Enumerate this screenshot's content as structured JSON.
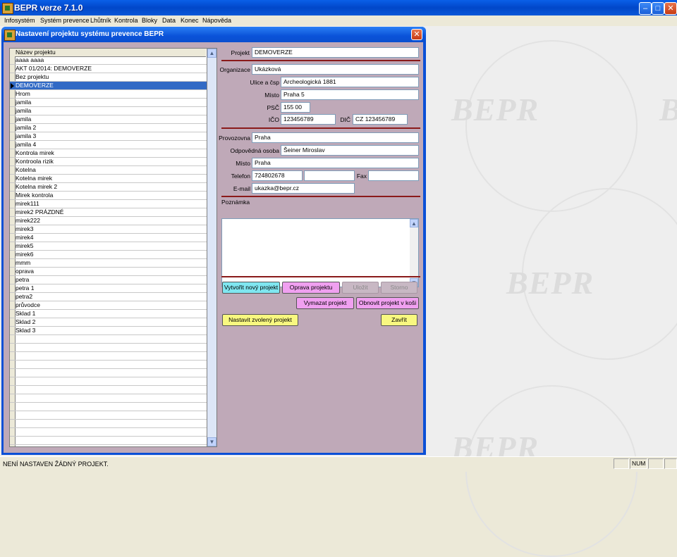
{
  "app": {
    "title": "BEPR verze 7.1.0"
  },
  "menu": [
    "Infosystém",
    "Systém prevence",
    "Lhůtník",
    "Kontrola",
    "Bloky",
    "Data",
    "Konec",
    "Nápověda"
  ],
  "watermark": "BEPR",
  "status": {
    "message": "NENÍ NASTAVEN ŽÁDNÝ PROJEKT.",
    "num": "NUM"
  },
  "dialog": {
    "title": "Nastavení projektu systému prevence BEPR",
    "grid": {
      "column_header": "Název projektu",
      "selected_index": 3,
      "rows": [
        "aaaa aaaa",
        "AKT 01/2014: DEMOVERZE",
        "Bez projektu",
        "DEMOVERZE",
        "Hrom",
        "jamila",
        "jamila",
        "jamila",
        "jamila 2",
        "jamila 3",
        "jamila 4",
        "Kontrola mirek",
        "Kontroola rizik",
        "Kotelna",
        "Kotelna mirek",
        "Kotelna mirek 2",
        "Mirek kontrola",
        "mirek111",
        "mirek2 PRÁZDNÉ",
        "mirek222",
        "mirek3",
        "mirek4",
        "mirek5",
        "mirek6",
        "mmm",
        "oprava",
        "petra",
        "petra 1",
        "petra2",
        "průvodce",
        "Sklad 1",
        "Sklad 2",
        "Sklad 3",
        "",
        "",
        "",
        "",
        "",
        "",
        "",
        "",
        "",
        "",
        "",
        "",
        ""
      ]
    },
    "form": {
      "project_label": "Projekt",
      "project_value": "DEMOVERZE",
      "org_label": "Organizace",
      "org_value": "Ukázková",
      "street_label": "Ulice a čsp",
      "street_value": "Archeologická 1881",
      "city_label": "Místo",
      "city_value": "Praha 5",
      "zip_label": "PSČ",
      "zip_value": "155 00",
      "ico_label": "IČO",
      "ico_value": "123456789",
      "dic_label": "DIČ",
      "dic_value": "CZ 123456789",
      "branch_label": "Provozovna",
      "branch_value": "Praha",
      "person_label": "Odpovědná osoba",
      "person_value": "Šeiner Miroslav",
      "place_label": "Místo",
      "place_value": "Praha",
      "phone_label": "Telefon",
      "phone_value": "724802678",
      "phone2_value": "",
      "fax_label": "Fax",
      "fax_value": "",
      "email_label": "E-mail",
      "email_value": "ukazka@bepr.cz",
      "note_label": "Poznámka",
      "note_value": ""
    },
    "buttons": {
      "new": "Vytvořit nový projekt",
      "edit": "Oprava projektu",
      "save": "Uložit",
      "cancel": "Storno",
      "delete": "Vymazat projekt",
      "restore": "Obnovit projekt v koši",
      "set": "Nastavit zvolený projekt",
      "close": "Zavřít"
    }
  }
}
